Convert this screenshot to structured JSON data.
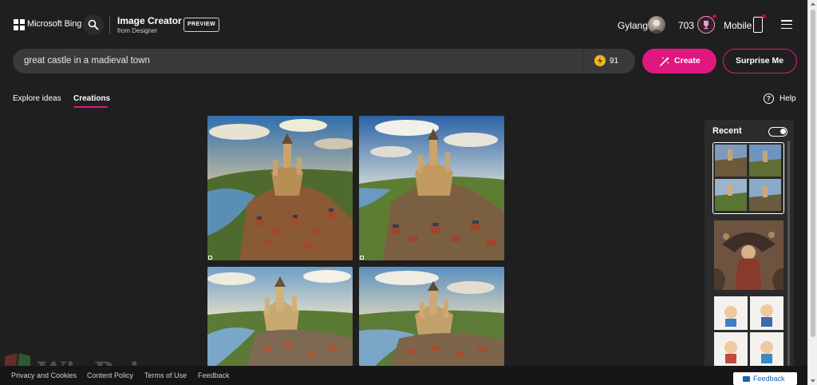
{
  "header": {
    "brand": "Microsoft Bing",
    "app_title": "Image Creator",
    "app_subtitle": "from Designer",
    "badge": "PREVIEW",
    "username": "Gylang",
    "points": "703",
    "mobile_label": "Mobile"
  },
  "prompt": {
    "value": "great castle in a madieval town",
    "boosts": "91",
    "create_label": "Create",
    "surprise_label": "Surprise Me"
  },
  "tabs": {
    "explore": "Explore ideas",
    "creations": "Creations",
    "help": "Help",
    "help_icon_glyph": "?"
  },
  "results": {
    "images": [
      {
        "alt": "castle-image-1"
      },
      {
        "alt": "castle-image-2"
      },
      {
        "alt": "castle-image-3"
      },
      {
        "alt": "castle-image-4"
      }
    ]
  },
  "recent": {
    "title": "Recent",
    "toggle_on": true
  },
  "footer": {
    "privacy": "Privacy and Cookies",
    "content_policy": "Content Policy",
    "terms": "Terms of Use",
    "feedback": "Feedback",
    "feedback_button": "Feedback"
  },
  "watermark": "WinPoin",
  "colors": {
    "accent": "#e0177f",
    "background": "#1f1f1f",
    "boost": "#f3b81f"
  }
}
